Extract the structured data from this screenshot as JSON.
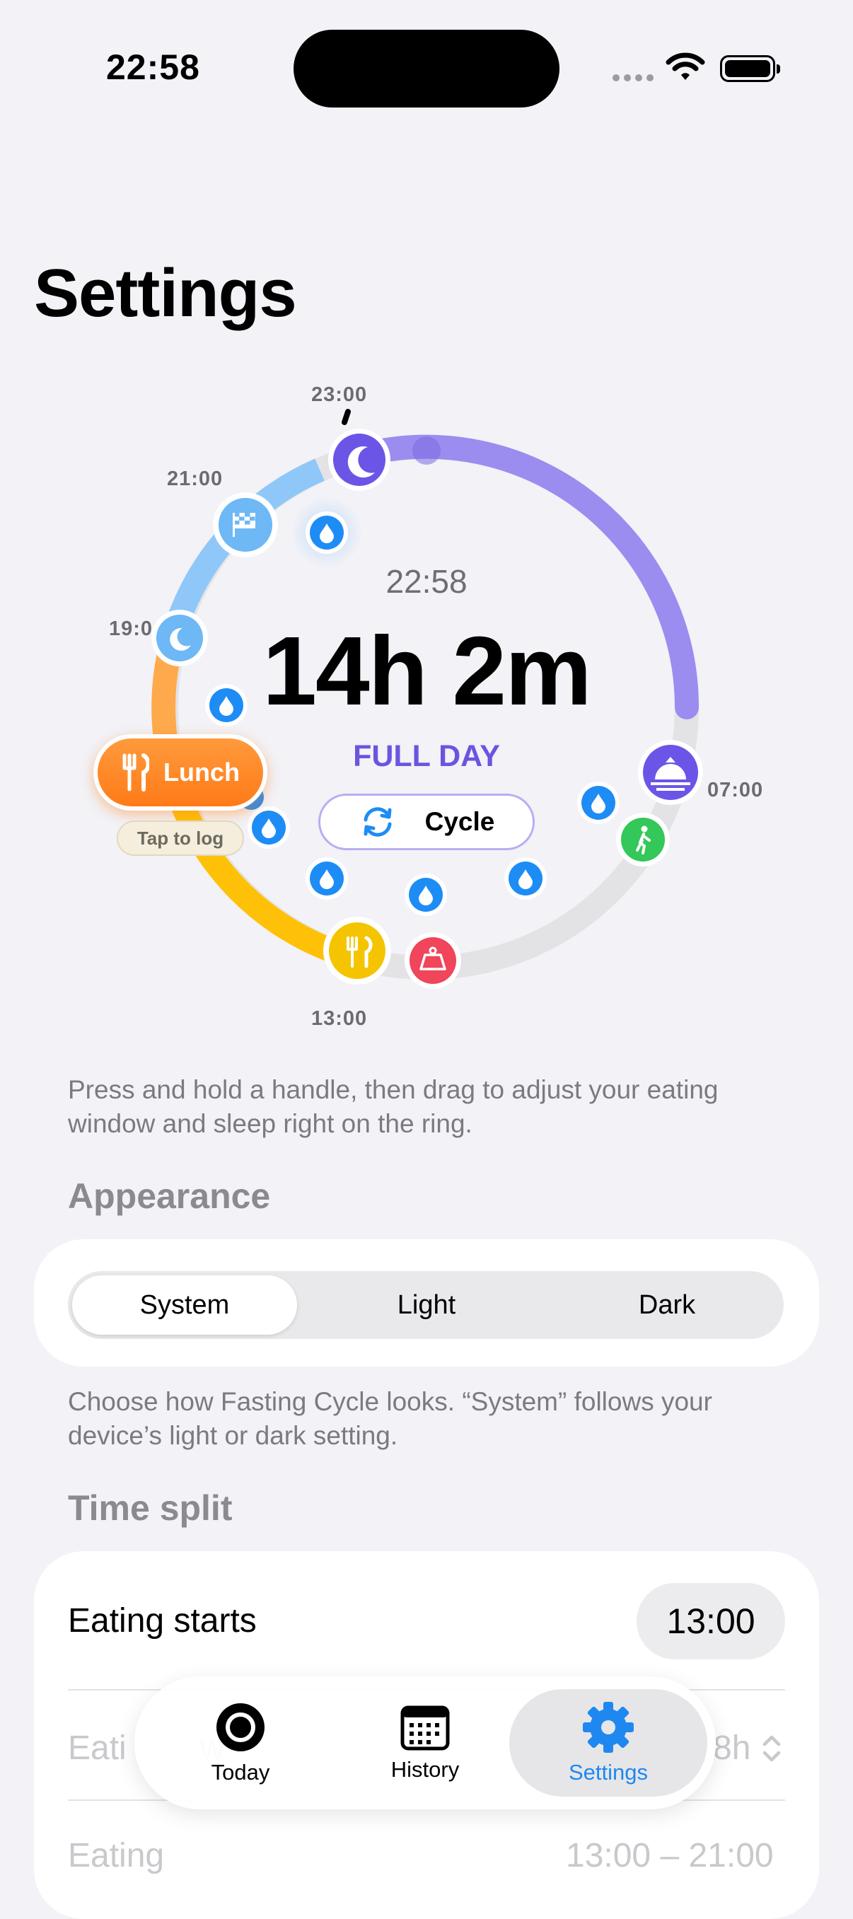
{
  "status_bar": {
    "time": "22:58"
  },
  "page": {
    "title": "Settings"
  },
  "dial": {
    "time_labels": {
      "t2300": "23:00",
      "t2100": "21:00",
      "t1900": "19:0",
      "t0700": "07:00",
      "t1300": "13:00"
    },
    "current_time": "22:58",
    "duration": "14h 2m",
    "phase": "FULL DAY",
    "cycle_button": "Cycle",
    "meal_pill": "Lunch",
    "tap_to_log": "Tap to log",
    "colors": {
      "sleep": "#9B8CF0",
      "eating": "#FFC107",
      "evening": "#8FC8F8",
      "afternoon": "#FFA94D",
      "track": "#E3E3E6",
      "water": "#1E8CF5"
    }
  },
  "hint_text": "Press and hold a handle, then drag to adjust your eating window and sleep right on the ring.",
  "appearance": {
    "header": "Appearance",
    "options": [
      "System",
      "Light",
      "Dark"
    ],
    "selected": "System",
    "footnote": "Choose how Fasting Cycle looks. “System” follows your device’s light or dark setting."
  },
  "time_split": {
    "header": "Time split",
    "eating_starts_label": "Eating starts",
    "eating_starts_value": "13:00",
    "eating_window_label": "Eati",
    "eating_window_label_tail": "w",
    "eating_window_value": "8h",
    "eating_label": "Eating",
    "eating_range": "13:00 – 21:00"
  },
  "tab_bar": {
    "tabs": [
      {
        "label": "Today",
        "icon": "circle-ring-icon"
      },
      {
        "label": "History",
        "icon": "calendar-icon"
      },
      {
        "label": "Settings",
        "icon": "gear-icon"
      }
    ],
    "active": "Settings",
    "active_color": "#1E88F0"
  }
}
